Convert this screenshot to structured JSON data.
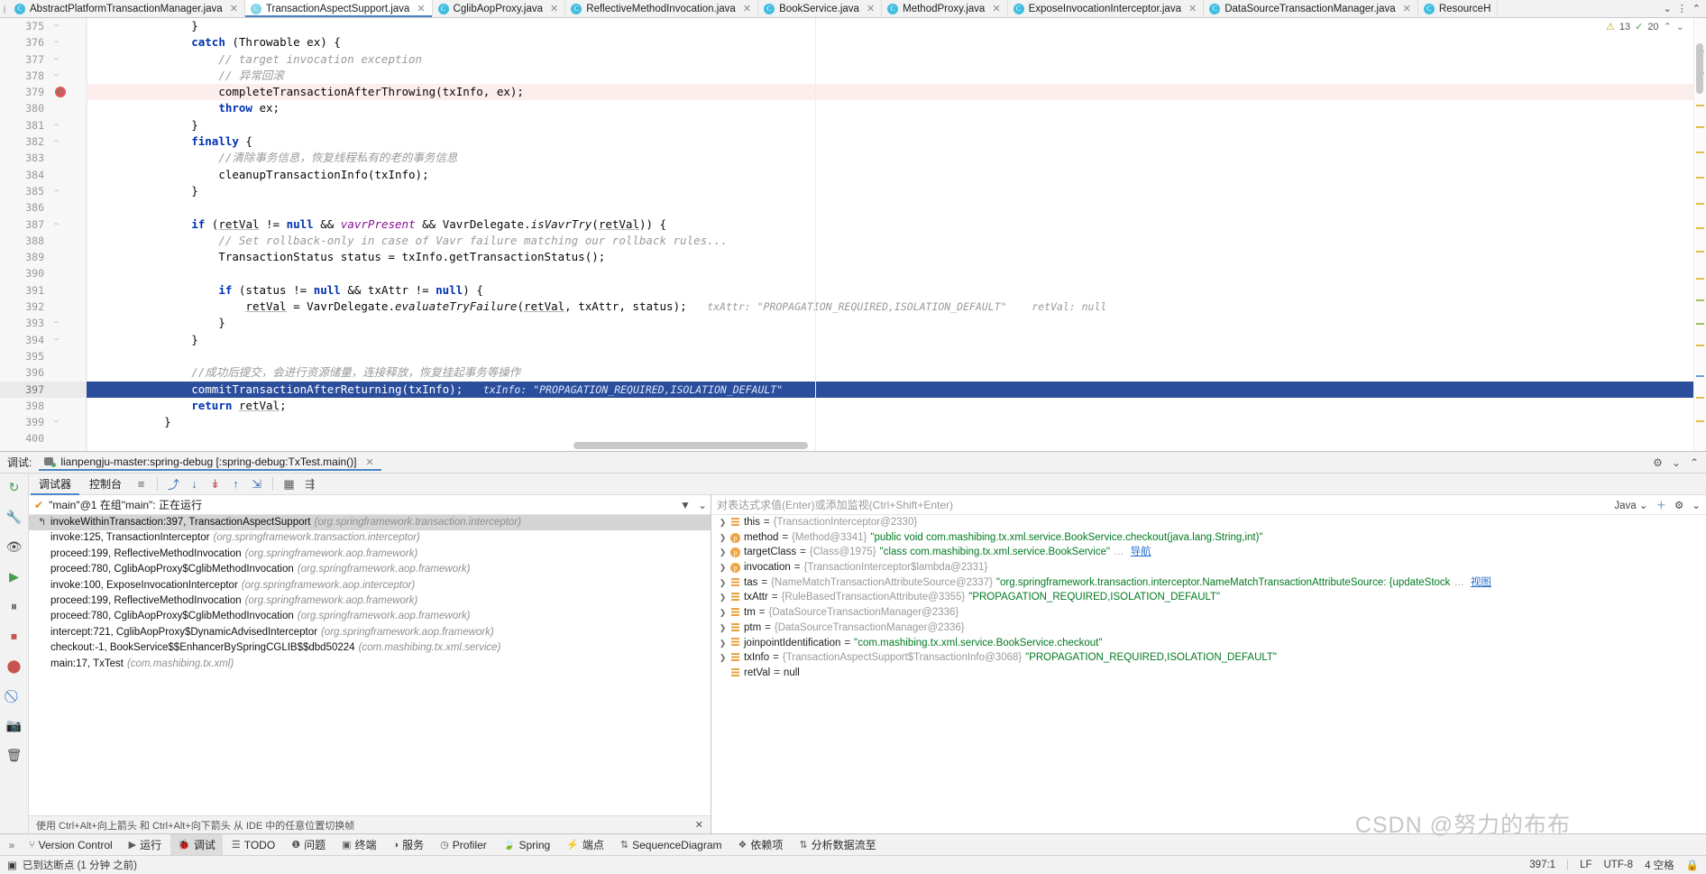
{
  "tabs": [
    {
      "label": "AbstractPlatformTransactionManager.java",
      "active": false
    },
    {
      "label": "TransactionAspectSupport.java",
      "active": true
    },
    {
      "label": "CglibAopProxy.java",
      "active": false
    },
    {
      "label": "ReflectiveMethodInvocation.java",
      "active": false
    },
    {
      "label": "BookService.java",
      "active": false
    },
    {
      "label": "MethodProxy.java",
      "active": false
    },
    {
      "label": "ExposeInvocationInterceptor.java",
      "active": false
    },
    {
      "label": "DataSourceTransactionManager.java",
      "active": false
    },
    {
      "label": "ResourceH",
      "active": false
    }
  ],
  "editor": {
    "warning_count": "13",
    "ok_count": "20",
    "first_line": 375,
    "lines": [
      {
        "n": 375,
        "fold": "−",
        "html": "        }"
      },
      {
        "n": 376,
        "fold": "−",
        "html": "        <span class=\"kw\">catch</span> (Throwable ex) {"
      },
      {
        "n": 377,
        "fold": "−",
        "html": "            <span class=\"cmt\">// target invocation exception</span>"
      },
      {
        "n": 378,
        "fold": "−",
        "html": "            <span class=\"cmt\">// 异常回滚</span>"
      },
      {
        "n": 379,
        "fold": "",
        "bp": true,
        "cls": "err",
        "html": "            completeTransactionAfterThrowing(txInfo, ex);"
      },
      {
        "n": 380,
        "fold": "",
        "html": "            <span class=\"kw\">throw</span> ex;"
      },
      {
        "n": 381,
        "fold": "−",
        "html": "        }"
      },
      {
        "n": 382,
        "fold": "−",
        "html": "        <span class=\"kw\">finally</span> {"
      },
      {
        "n": 383,
        "fold": "",
        "html": "            <span class=\"cmt\">//清除事务信息，恢复线程私有的老的事务信息</span>"
      },
      {
        "n": 384,
        "fold": "",
        "html": "            cleanupTransactionInfo(txInfo);"
      },
      {
        "n": 385,
        "fold": "−",
        "html": "        }"
      },
      {
        "n": 386,
        "fold": "",
        "html": ""
      },
      {
        "n": 387,
        "fold": "−",
        "html": "        <span class=\"kw\">if</span> (<span class=\"und\">retVal</span> != <span class=\"kw\">null</span> &amp;&amp; <span class=\"fld\">vavrPresent</span> &amp;&amp; VavrDelegate.<span class=\"mth\">isVavrTry</span>(<span class=\"und\">retVal</span>)) {"
      },
      {
        "n": 388,
        "fold": "",
        "html": "            <span class=\"cmt\">// Set rollback-only in case of Vavr failure matching our rollback rules...</span>"
      },
      {
        "n": 389,
        "fold": "",
        "html": "            TransactionStatus status = txInfo.getTransactionStatus();"
      },
      {
        "n": 390,
        "fold": "",
        "html": ""
      },
      {
        "n": 391,
        "fold": "",
        "html": "            <span class=\"kw\">if</span> (status != <span class=\"kw\">null</span> &amp;&amp; txAttr != <span class=\"kw\">null</span>) {"
      },
      {
        "n": 392,
        "fold": "",
        "html": "                <span class=\"und\">retVal</span> = VavrDelegate.<span class=\"mth\">evaluateTryFailure</span>(<span class=\"und\">retVal</span>, txAttr, status);   <span class=\"hint\">txAttr: \"PROPAGATION_REQUIRED,ISOLATION_DEFAULT\"    retVal: null</span>"
      },
      {
        "n": 393,
        "fold": "−",
        "html": "            }"
      },
      {
        "n": 394,
        "fold": "−",
        "html": "        }"
      },
      {
        "n": 395,
        "fold": "",
        "html": ""
      },
      {
        "n": 396,
        "fold": "",
        "html": "        <span class=\"cmt\">//成功后提交，会进行资源储量，连接释放，恢复挂起事务等操作</span>"
      },
      {
        "n": 397,
        "fold": "",
        "cls": "exec",
        "html": "        commitTransactionAfterReturning(txInfo);   <span class=\"hint\">txInfo: \"PROPAGATION_REQUIRED,ISOLATION_DEFAULT\"</span>"
      },
      {
        "n": 398,
        "fold": "",
        "html": "        <span class=\"kw\">return</span> <span class=\"und\">retVal</span>;"
      },
      {
        "n": 399,
        "fold": "−",
        "html": "    }"
      },
      {
        "n": 400,
        "fold": "",
        "html": ""
      }
    ]
  },
  "debug": {
    "title_label": "调试:",
    "run_config": "lianpengju-master:spring-debug [:spring-debug:TxTest.main()]",
    "tabs": [
      {
        "label": "调试器",
        "active": true
      },
      {
        "label": "控制台",
        "active": false
      }
    ],
    "toolbar_buttons": [
      {
        "name": "show-execution-point",
        "glyph": "≡"
      },
      {
        "name": "step-over",
        "glyph": "⤴"
      },
      {
        "name": "step-into",
        "glyph": "↓"
      },
      {
        "name": "force-step-into",
        "glyph": "↡"
      },
      {
        "name": "step-out",
        "glyph": "↑"
      },
      {
        "name": "run-to-cursor",
        "glyph": "⇲"
      },
      {
        "name": "evaluate-expression",
        "glyph": "▦"
      },
      {
        "name": "settings-layout",
        "glyph": "⇶"
      }
    ],
    "thread_label": "\"main\"@1 在组\"main\": 正在运行",
    "frames": [
      {
        "method": "invokeWithinTransaction:397, TransactionAspectSupport",
        "pkg": "(org.springframework.transaction.interceptor)",
        "selected": true
      },
      {
        "method": "invoke:125, TransactionInterceptor",
        "pkg": "(org.springframework.transaction.interceptor)",
        "selected": false
      },
      {
        "method": "proceed:199, ReflectiveMethodInvocation",
        "pkg": "(org.springframework.aop.framework)",
        "selected": false
      },
      {
        "method": "proceed:780, CglibAopProxy$CglibMethodInvocation",
        "pkg": "(org.springframework.aop.framework)",
        "selected": false
      },
      {
        "method": "invoke:100, ExposeInvocationInterceptor",
        "pkg": "(org.springframework.aop.interceptor)",
        "selected": false
      },
      {
        "method": "proceed:199, ReflectiveMethodInvocation",
        "pkg": "(org.springframework.aop.framework)",
        "selected": false
      },
      {
        "method": "proceed:780, CglibAopProxy$CglibMethodInvocation",
        "pkg": "(org.springframework.aop.framework)",
        "selected": false
      },
      {
        "method": "intercept:721, CglibAopProxy$DynamicAdvisedInterceptor",
        "pkg": "(org.springframework.aop.framework)",
        "selected": false
      },
      {
        "method": "checkout:-1, BookService$$EnhancerBySpringCGLIB$$dbd50224",
        "pkg": "(com.mashibing.tx.xml.service)",
        "selected": false
      },
      {
        "method": "main:17, TxTest",
        "pkg": "(com.mashibing.tx.xml)",
        "selected": false
      }
    ],
    "frames_hint": "使用 Ctrl+Alt+向上箭头 和 Ctrl+Alt+向下箭头 从 IDE 中的任意位置切换帧",
    "watch_placeholder": "对表达式求值(Enter)或添加监视(Ctrl+Shift+Enter)",
    "lang_selector": "Java",
    "variables": [
      {
        "icon": "field",
        "name": "this",
        "eq": " = ",
        "ref": "{TransactionInterceptor@2330}",
        "str": "",
        "expandable": true
      },
      {
        "icon": "param",
        "name": "method",
        "eq": " = ",
        "ref": "{Method@3341}",
        "str": "\"public void com.mashibing.tx.xml.service.BookService.checkout(java.lang.String,int)\"",
        "expandable": true
      },
      {
        "icon": "param",
        "name": "targetClass",
        "eq": " = ",
        "ref": "{Class@1975}",
        "str": "\"class com.mashibing.tx.xml.service.BookService\"",
        "ellipsis": "…",
        "nav": "导航",
        "expandable": true
      },
      {
        "icon": "param",
        "name": "invocation",
        "eq": " = ",
        "ref": "{TransactionInterceptor$lambda@2331}",
        "str": "",
        "expandable": true
      },
      {
        "icon": "field",
        "name": "tas",
        "eq": " = ",
        "ref": "{NameMatchTransactionAttributeSource@2337}",
        "str": "\"org.springframework.transaction.interceptor.NameMatchTransactionAttributeSource: {updateStock",
        "ellipsis": "…",
        "nav": "视图",
        "expandable": true
      },
      {
        "icon": "field",
        "name": "txAttr",
        "eq": " = ",
        "ref": "{RuleBasedTransactionAttribute@3355}",
        "str": "\"PROPAGATION_REQUIRED,ISOLATION_DEFAULT\"",
        "expandable": true
      },
      {
        "icon": "field",
        "name": "tm",
        "eq": " = ",
        "ref": "{DataSourceTransactionManager@2336}",
        "str": "",
        "expandable": true
      },
      {
        "icon": "field",
        "name": "ptm",
        "eq": " = ",
        "ref": "{DataSourceTransactionManager@2336}",
        "str": "",
        "expandable": true
      },
      {
        "icon": "field",
        "name": "joinpointIdentification",
        "eq": " = ",
        "ref": "",
        "str": "\"com.mashibing.tx.xml.service.BookService.checkout\"",
        "expandable": true
      },
      {
        "icon": "field",
        "name": "txInfo",
        "eq": " = ",
        "ref": "{TransactionAspectSupport$TransactionInfo@3068}",
        "str": "\"PROPAGATION_REQUIRED,ISOLATION_DEFAULT\"",
        "expandable": true
      },
      {
        "icon": "field",
        "name": "retVal",
        "eq": " = ",
        "ref": "",
        "nullval": "null",
        "str": "",
        "expandable": false
      }
    ]
  },
  "toolwindows": [
    {
      "label": "Version Control",
      "icon": "⑂",
      "active": false
    },
    {
      "label": "运行",
      "icon": "▶",
      "active": false
    },
    {
      "label": "调试",
      "icon": "🐞",
      "active": true
    },
    {
      "label": "TODO",
      "icon": "☰",
      "active": false
    },
    {
      "label": "问题",
      "icon": "❶",
      "active": false
    },
    {
      "label": "终端",
      "icon": "▣",
      "active": false
    },
    {
      "label": "服务",
      "icon": "◑",
      "active": false
    },
    {
      "label": "Profiler",
      "icon": "◷",
      "active": false
    },
    {
      "label": "Spring",
      "icon": "🍃",
      "active": false
    },
    {
      "label": "端点",
      "icon": "⚡",
      "active": false
    },
    {
      "label": "SequenceDiagram",
      "icon": "⇅",
      "active": false
    },
    {
      "label": "依赖项",
      "icon": "❖",
      "active": false
    },
    {
      "label": "分析数据流至",
      "icon": "⇅",
      "active": false
    }
  ],
  "statusbar": {
    "message": "已到达断点 (1 分钟 之前)",
    "caret": "397:1",
    "line_sep": "LF",
    "encoding": "UTF-8",
    "indent": "4 空格",
    "lock": "🔒"
  },
  "watermark": "CSDN @努力的布布"
}
